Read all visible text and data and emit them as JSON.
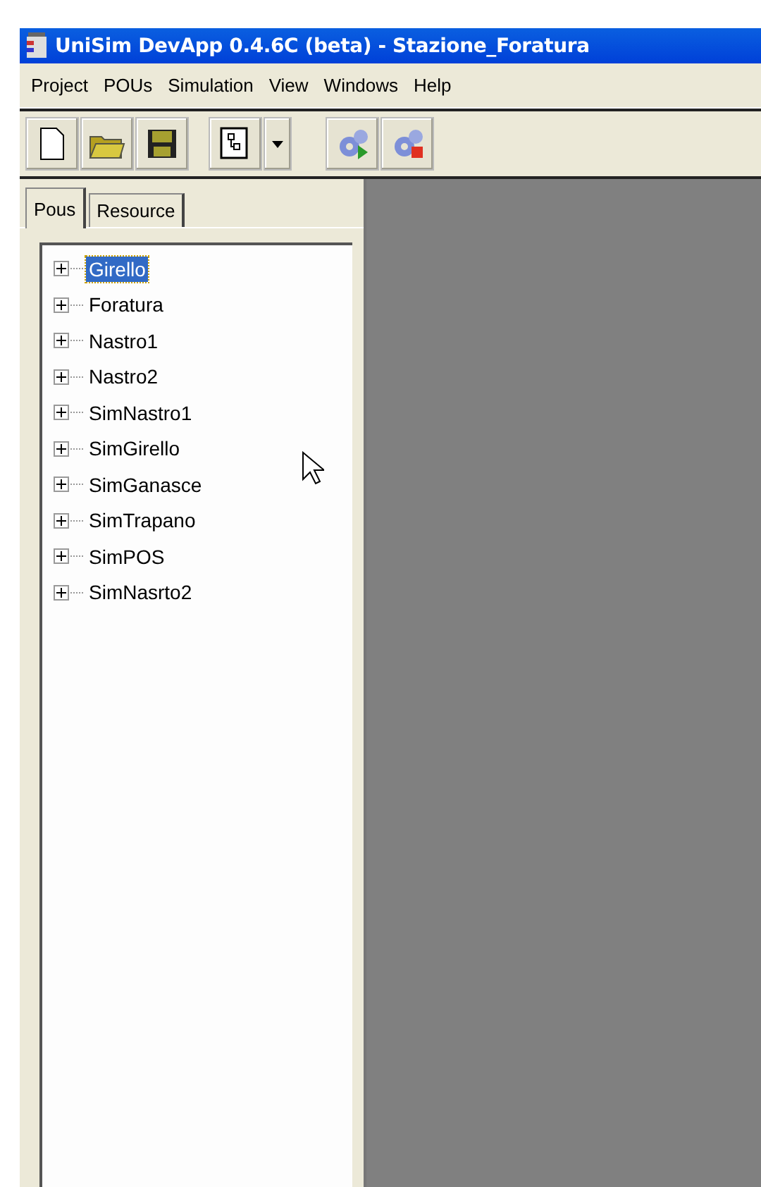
{
  "window": {
    "title": "UniSim DevApp 0.4.6C (beta) - Stazione_Foratura"
  },
  "menu": [
    "Project",
    "POUs",
    "Simulation",
    "View",
    "Windows",
    "Help"
  ],
  "tabs": [
    {
      "label": "Pous",
      "selected": true
    },
    {
      "label": "Resource",
      "selected": false
    }
  ],
  "tree": {
    "items": [
      {
        "label": "Girello",
        "selected": true,
        "expanded": false
      },
      {
        "label": "Foratura",
        "selected": false,
        "expanded": false
      },
      {
        "label": "Nastro1",
        "selected": false,
        "expanded": false
      },
      {
        "label": "Nastro2",
        "selected": false,
        "expanded": false
      },
      {
        "label": "SimNastro1",
        "selected": false,
        "expanded": false
      },
      {
        "label": "SimGirello",
        "selected": false,
        "expanded": false
      },
      {
        "label": "SimGanasce",
        "selected": false,
        "expanded": false
      },
      {
        "label": "SimTrapano",
        "selected": false,
        "expanded": false
      },
      {
        "label": "SimPOS",
        "selected": false,
        "expanded": false
      },
      {
        "label": "SimNasrto2",
        "selected": false,
        "expanded": false
      }
    ]
  }
}
